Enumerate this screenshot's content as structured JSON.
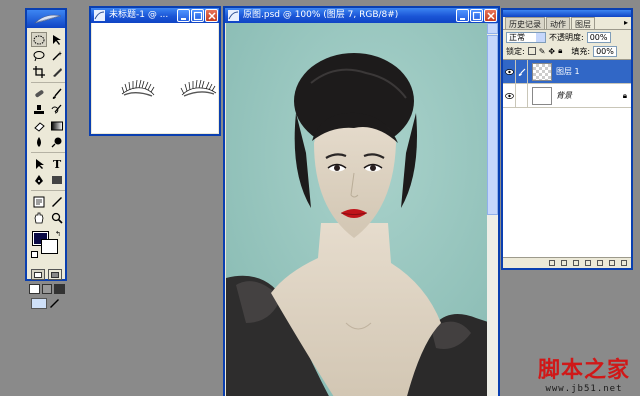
{
  "doc_small": {
    "title": "未标题-1 @ ..."
  },
  "doc_main": {
    "title": "原图.psd @ 100% (图层 7, RGB/8#)"
  },
  "layers_panel": {
    "tabs": [
      "历史记录",
      "动作",
      "图层"
    ],
    "blend_mode": "正常",
    "opacity_label": "不透明度:",
    "opacity_value": "00%",
    "lock_label": "锁定:",
    "fill_label": "填充:",
    "fill_value": "00%",
    "layers": [
      {
        "name": "图层 1",
        "active": true
      },
      {
        "name": "背景",
        "active": false
      }
    ]
  },
  "watermark": {
    "brand": "脚本之家",
    "url": "www.jb51.net"
  },
  "colors": {
    "foreground": "#0b0b45",
    "background": "#ffffff",
    "canvas_bg": "#9ac8c1",
    "workspace": "#8a8a8a"
  },
  "icons": [
    "photoshop-feather-icon",
    "eye-icon",
    "brush-icon",
    "lock-icon",
    "minimize-icon",
    "maximize-icon",
    "close-icon"
  ]
}
